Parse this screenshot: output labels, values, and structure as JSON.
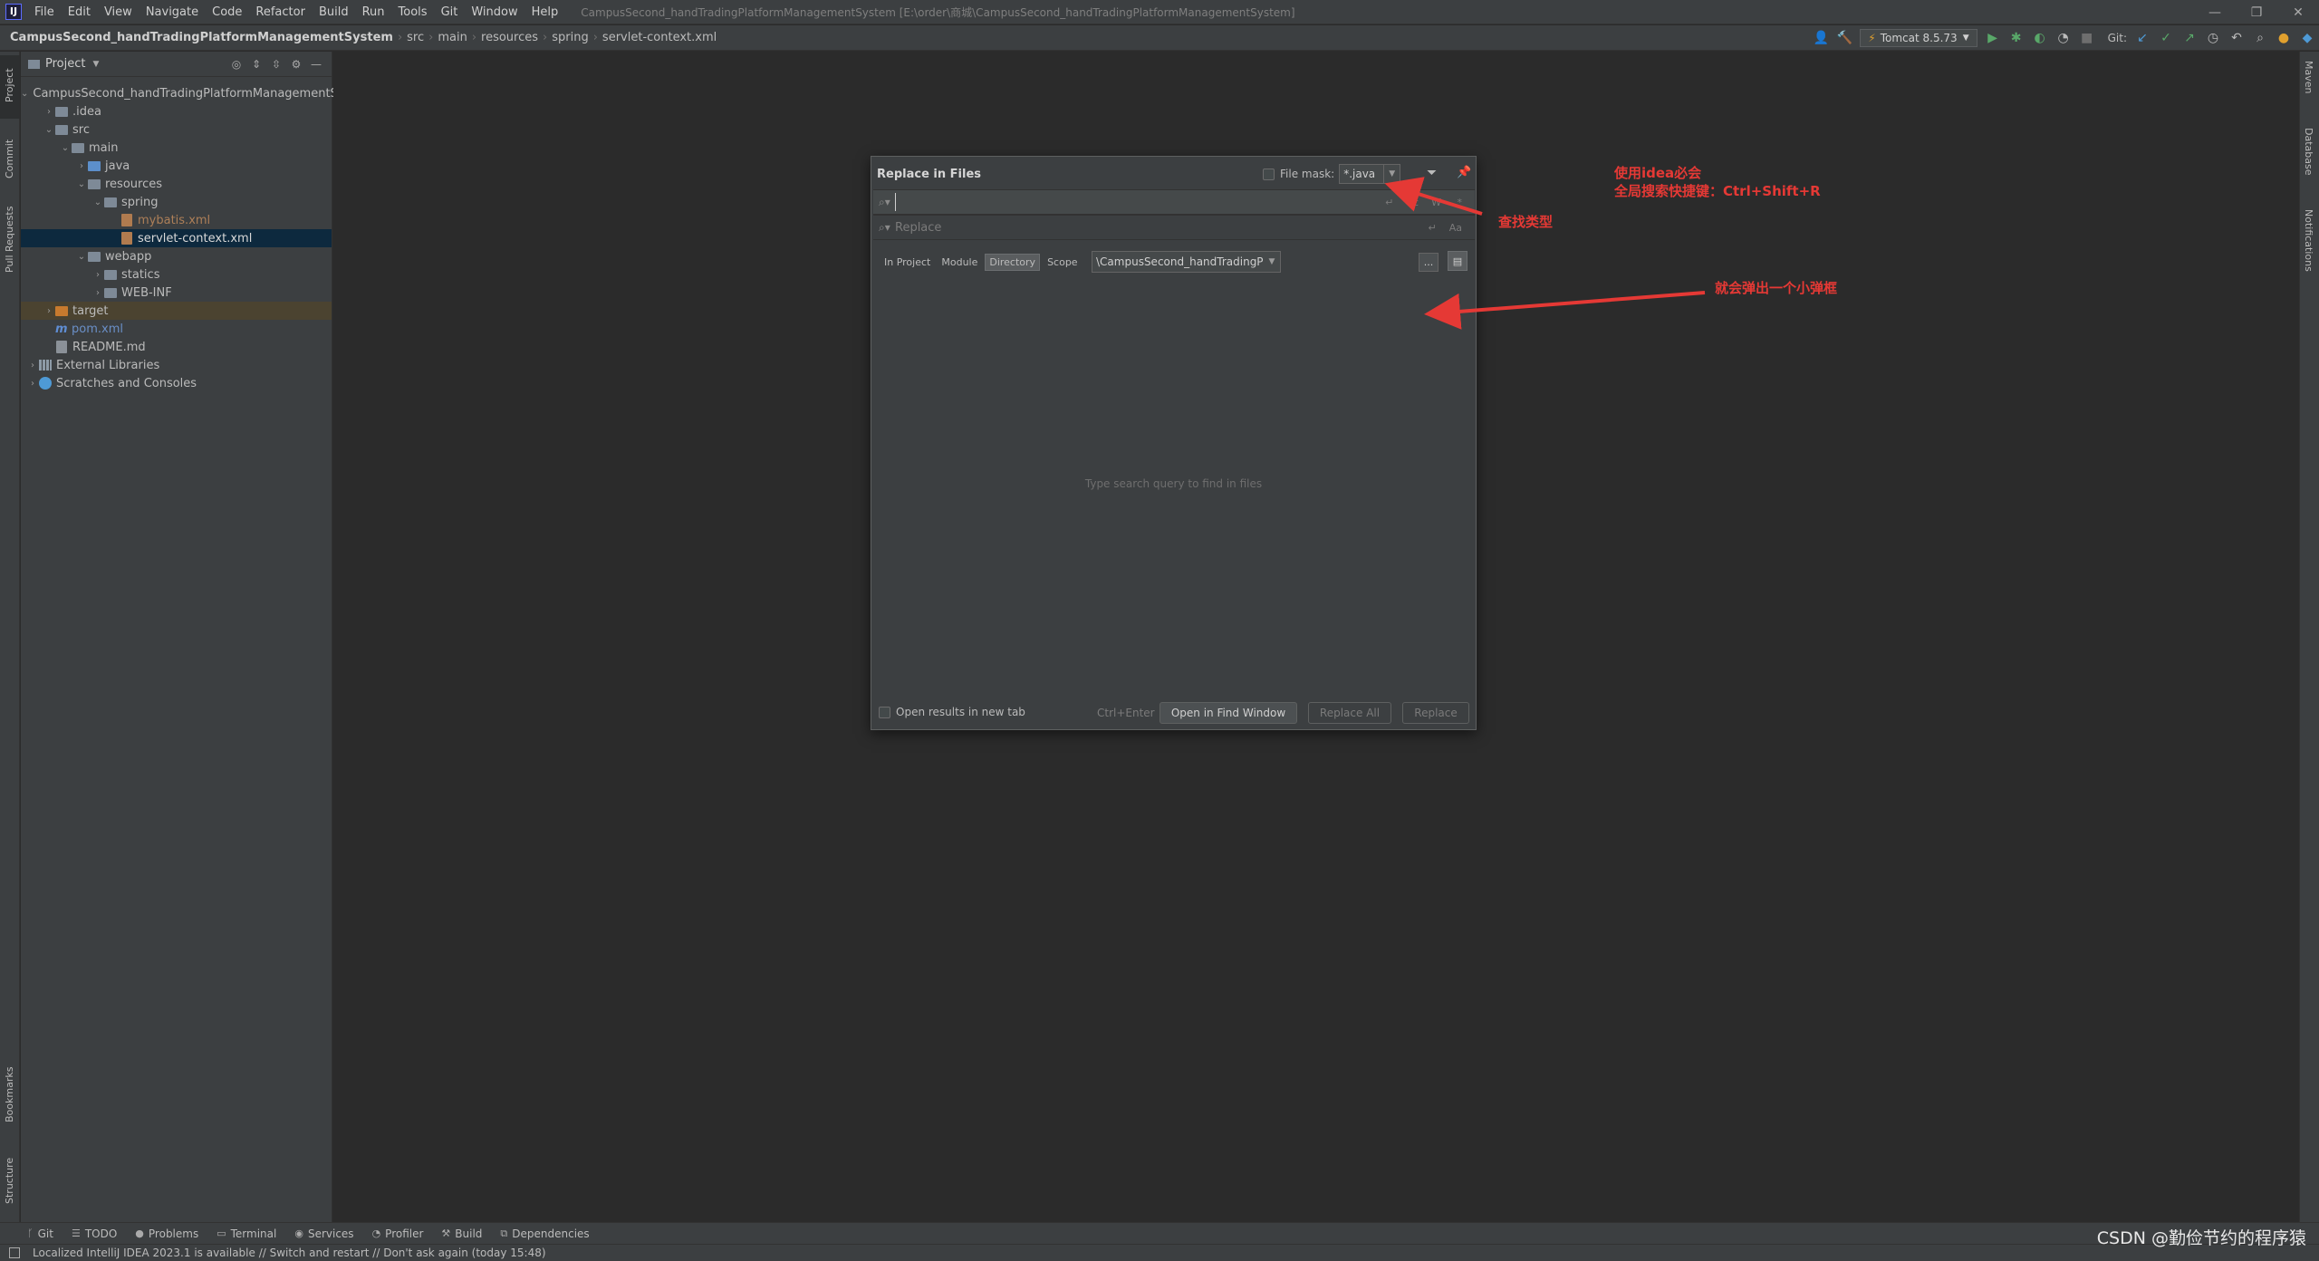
{
  "titlebar": {
    "logo": "IJ",
    "menu": [
      "File",
      "Edit",
      "View",
      "Navigate",
      "Code",
      "Refactor",
      "Build",
      "Run",
      "Tools",
      "Git",
      "Window",
      "Help"
    ],
    "window_title": "CampusSecond_handTradingPlatformManagementSystem [E:\\order\\商城\\CampusSecond_handTradingPlatformManagementSystem]",
    "controls": [
      "—",
      "❐",
      "✕"
    ]
  },
  "navbar": {
    "breadcrumbs": [
      "CampusSecond_handTradingPlatformManagementSystem",
      "src",
      "main",
      "resources",
      "spring",
      "servlet-context.xml"
    ],
    "run_config": "Tomcat 8.5.73",
    "git_label": "Git:"
  },
  "left_stripe": [
    "Project",
    "Commit",
    "Pull Requests",
    "Bookmarks",
    "Structure"
  ],
  "right_stripe": [
    "Maven",
    "Database",
    "Notifications"
  ],
  "project_panel": {
    "title": "Project",
    "tree": [
      {
        "label": "CampusSecond_handTradingPlatformManagementS",
        "depth": 0,
        "chev": "v",
        "icon": "module"
      },
      {
        "label": ".idea",
        "depth": 1,
        "chev": ">",
        "icon": "folder"
      },
      {
        "label": "src",
        "depth": 1,
        "chev": "v",
        "icon": "folder"
      },
      {
        "label": "main",
        "depth": 2,
        "chev": "v",
        "icon": "folder"
      },
      {
        "label": "java",
        "depth": 3,
        "chev": ">",
        "icon": "folder-blue"
      },
      {
        "label": "resources",
        "depth": 3,
        "chev": "v",
        "icon": "folder-res"
      },
      {
        "label": "spring",
        "depth": 4,
        "chev": "v",
        "icon": "folder"
      },
      {
        "label": "mybatis.xml",
        "depth": 5,
        "chev": "",
        "icon": "xml"
      },
      {
        "label": "servlet-context.xml",
        "depth": 5,
        "chev": "",
        "icon": "xml",
        "selected": true
      },
      {
        "label": "webapp",
        "depth": 3,
        "chev": "v",
        "icon": "folder"
      },
      {
        "label": "statics",
        "depth": 4,
        "chev": ">",
        "icon": "folder"
      },
      {
        "label": "WEB-INF",
        "depth": 4,
        "chev": ">",
        "icon": "folder"
      },
      {
        "label": "target",
        "depth": 1,
        "chev": ">",
        "icon": "folder-orange",
        "highlight": true
      },
      {
        "label": "pom.xml",
        "depth": 1,
        "chev": "",
        "icon": "maven"
      },
      {
        "label": "README.md",
        "depth": 1,
        "chev": "",
        "icon": "md"
      },
      {
        "label": "External Libraries",
        "depth": 0,
        "chev": ">",
        "icon": "lib"
      },
      {
        "label": "Scratches and Consoles",
        "depth": 0,
        "chev": ">",
        "icon": "scratch"
      }
    ]
  },
  "dialog": {
    "title": "Replace in Files",
    "file_mask_label": "File mask:",
    "file_mask_value": "*.java",
    "find_value": "",
    "replace_placeholder": "Replace",
    "find_options": [
      "Cc",
      "W",
      ".*"
    ],
    "replace_options": [
      "Aa"
    ],
    "scope_tabs": [
      "In Project",
      "Module",
      "Directory",
      "Scope"
    ],
    "active_scope": "Directory",
    "directory_value": "\\CampusSecond_handTradingPlatformManagementSyst",
    "browse_label": "...",
    "empty_hint": "Type search query to find in files",
    "open_new_tab_label": "Open results in new tab",
    "shortcut": "Ctrl+Enter",
    "btn_open_find": "Open in Find Window",
    "btn_replace_all": "Replace All",
    "btn_replace": "Replace"
  },
  "annotations": {
    "top_line1": "使用idea必会",
    "top_line2": "全局搜索快捷键：Ctrl+Shift+R",
    "file_type": "查找类型",
    "popup": "就会弹出一个小弹框",
    "color": "#e53935"
  },
  "bottom_toolbar": [
    "Git",
    "TODO",
    "Problems",
    "Terminal",
    "Services",
    "Profiler",
    "Build",
    "Dependencies"
  ],
  "statusbar": {
    "text": "Localized IntelliJ IDEA 2023.1 is available // Switch and restart // Don't ask again (today 15:48)"
  },
  "watermark": "CSDN @勤俭节约的程序猿"
}
